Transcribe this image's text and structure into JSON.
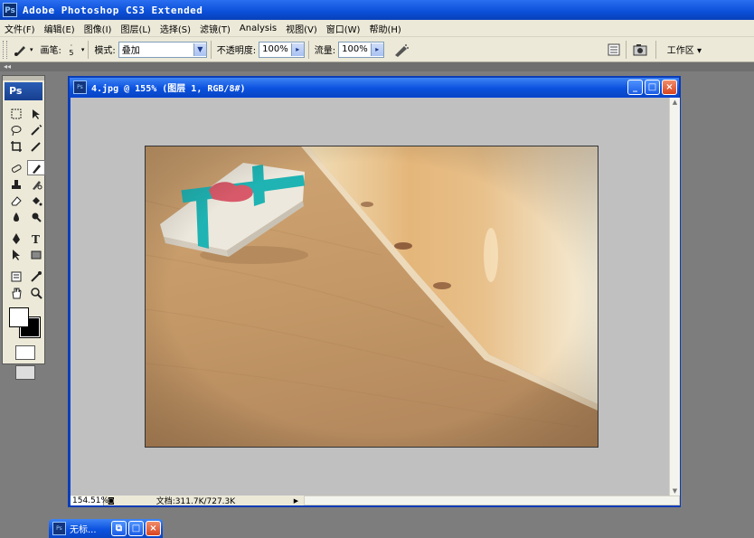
{
  "app": {
    "title": "Adobe Photoshop CS3 Extended",
    "logo": "Ps"
  },
  "menu": [
    "文件(F)",
    "编辑(E)",
    "图像(I)",
    "图层(L)",
    "选择(S)",
    "滤镜(T)",
    "Analysis",
    "视图(V)",
    "窗口(W)",
    "帮助(H)"
  ],
  "options": {
    "brush_label": "画笔:",
    "brush_size": "5",
    "mode_label": "模式:",
    "mode_value": "叠加",
    "opacity_label": "不透明度:",
    "opacity_value": "100%",
    "flow_label": "流量:",
    "flow_value": "100%",
    "workspace_label": "工作区 ▾"
  },
  "strip": {
    "collapse_handle": "◂◂"
  },
  "toolbox": {
    "logo": "Ps"
  },
  "document": {
    "title": "4.jpg @ 155% (图层 1, RGB/8#)",
    "zoom": "154.51%",
    "doc_info": "文档:311.7K/727.3K",
    "btn_min": "_",
    "btn_max": "□",
    "btn_close": "×"
  },
  "minimized": {
    "title": "无标...",
    "btn_restore": "⧉",
    "btn_max": "□",
    "btn_close": "×"
  },
  "colors": {
    "accent": "#0a4fd8",
    "chrome": "#ece9d8",
    "workspace": "#7d7d7d",
    "canvas_bg": "#c0c0c0"
  }
}
